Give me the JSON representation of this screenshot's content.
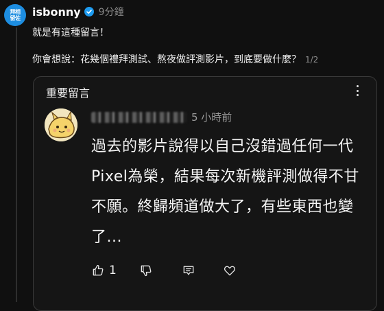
{
  "post": {
    "avatar_text_1": "拜相",
    "avatar_text_2": "留佐",
    "username": "isbonny",
    "time": "9分鐘",
    "line1": "就是有這種留言！",
    "line2": "你會想說：花幾個禮拜測試、熬夜做評測影片，到底要做什麼？",
    "pager": "1/2"
  },
  "card": {
    "title": "重要留言",
    "comment": {
      "time": "5 小時前",
      "body": "過去的影片說得以自己沒錯過任何一代Pixel為榮，結果每次新機評測做得不甘不願。終歸頻道做大了，有些東西也變了...",
      "like_count": "1"
    }
  },
  "colors": {
    "background": "#101010",
    "verified": "#1d9bf0",
    "avatar": "#1d8de0"
  },
  "icons": [
    "verified-icon",
    "more-icon",
    "thumbs-up-icon",
    "thumbs-down-icon",
    "reply-icon",
    "heart-icon"
  ]
}
